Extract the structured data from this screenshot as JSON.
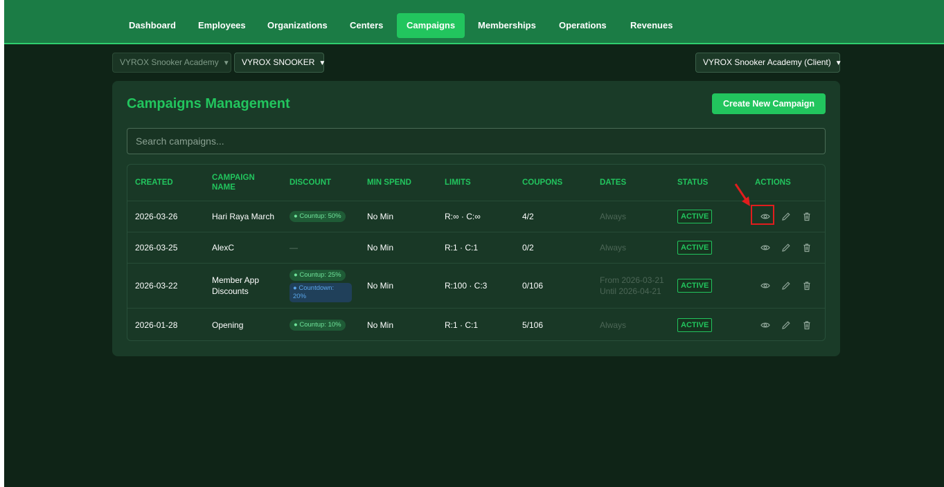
{
  "nav": {
    "items": [
      {
        "label": "Dashboard",
        "active": false
      },
      {
        "label": "Employees",
        "active": false
      },
      {
        "label": "Organizations",
        "active": false
      },
      {
        "label": "Centers",
        "active": false
      },
      {
        "label": "Campaigns",
        "active": true
      },
      {
        "label": "Memberships",
        "active": false
      },
      {
        "label": "Operations",
        "active": false
      },
      {
        "label": "Revenues",
        "active": false
      }
    ]
  },
  "selectors": {
    "academy": "VYROX Snooker Academy",
    "center": "VYROX SNOOKER",
    "client": "VYROX Snooker Academy (Client)",
    "caret_icon": "caret-down-icon"
  },
  "page": {
    "title": "Campaigns Management",
    "create_button": "Create New Campaign",
    "search_placeholder": "Search campaigns..."
  },
  "table": {
    "headers": [
      "CREATED",
      "CAMPAIGN NAME",
      "DISCOUNT",
      "MIN SPEND",
      "LIMITS",
      "COUPONS",
      "DATES",
      "STATUS",
      "ACTIONS"
    ],
    "rows": [
      {
        "created": "2026-03-26",
        "name": "Hari Raya March",
        "discounts": [
          {
            "text": "● Countup: 50%",
            "kind": "up"
          }
        ],
        "min_spend": "No Min",
        "limits": "R:∞ · C:∞",
        "coupons": "4/2",
        "dates": "Always",
        "status": "ACTIVE"
      },
      {
        "created": "2026-03-25",
        "name": "AlexC",
        "discounts": [],
        "discount_empty": "—",
        "min_spend": "No Min",
        "limits": "R:1 · C:1",
        "coupons": "0/2",
        "dates": "Always",
        "status": "ACTIVE"
      },
      {
        "created": "2026-03-22",
        "name": "Member App Discounts",
        "discounts": [
          {
            "text": "● Countup: 25%",
            "kind": "up"
          },
          {
            "text": "● Countdown: 20%",
            "kind": "down"
          }
        ],
        "min_spend": "No Min",
        "limits": "R:100 · C:3",
        "coupons": "0/106",
        "dates": "From 2026-03-21\nUntil 2026-04-21",
        "status": "ACTIVE"
      },
      {
        "created": "2026-01-28",
        "name": "Opening",
        "discounts": [
          {
            "text": "● Countup: 10%",
            "kind": "up"
          }
        ],
        "min_spend": "No Min",
        "limits": "R:1 · C:1",
        "coupons": "5/106",
        "dates": "Always",
        "status": "ACTIVE"
      }
    ],
    "action_icons": [
      "eye-icon",
      "pencil-icon",
      "trash-icon"
    ]
  },
  "colors": {
    "brand": "#22c55e",
    "nav_bg": "#1b7c45",
    "page_bg": "#0f2417",
    "card_bg": "#1a3b28",
    "annotation": "#e11d1d"
  }
}
